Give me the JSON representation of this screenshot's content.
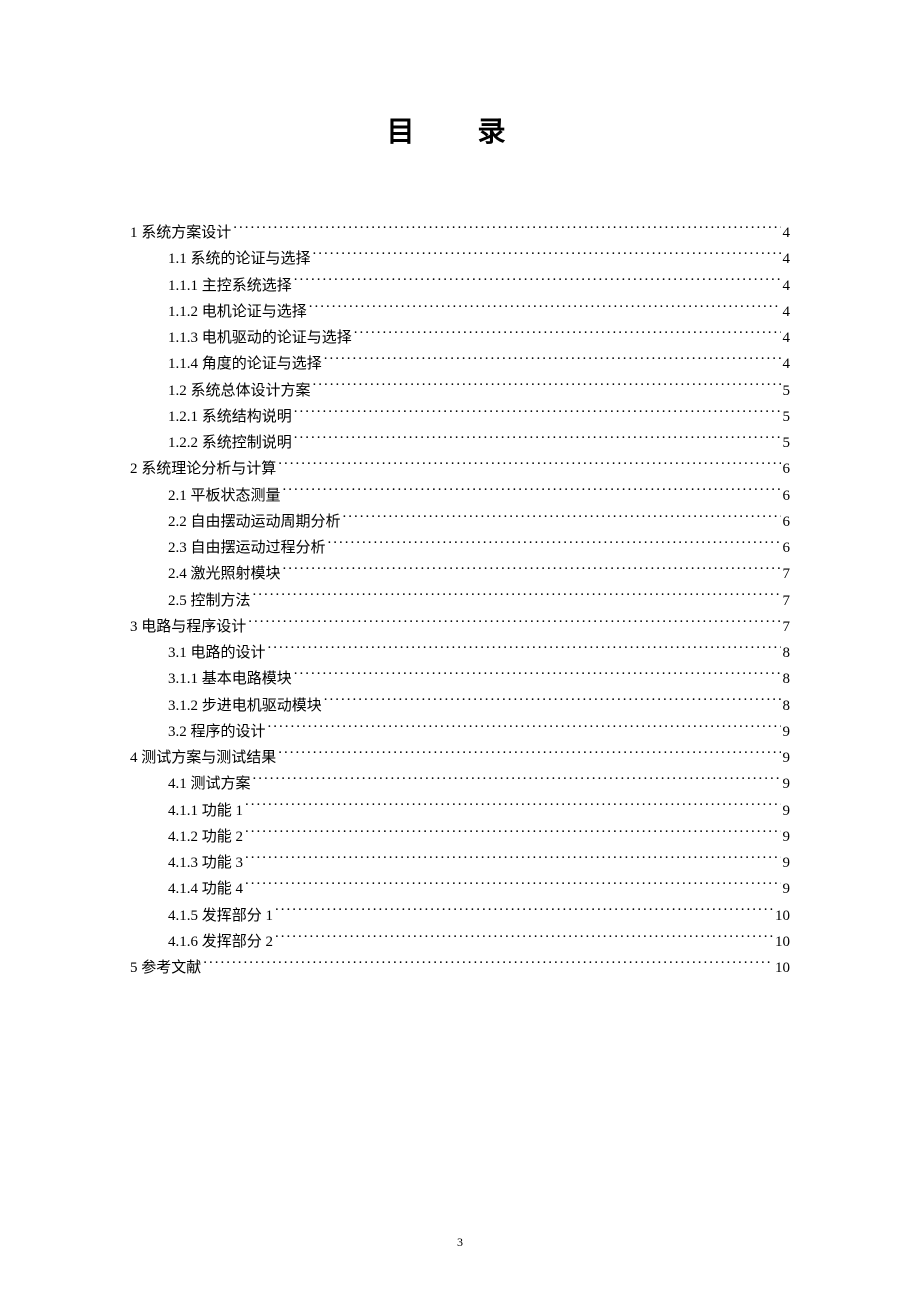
{
  "title": "目 录",
  "footer_page": "3",
  "toc": [
    {
      "level": 0,
      "label": "1 系统方案设计",
      "page": "4"
    },
    {
      "level": 1,
      "label": "1.1  系统的论证与选择",
      "page": "4"
    },
    {
      "level": 1,
      "label": "1.1.1 主控系统选择",
      "page": "4"
    },
    {
      "level": 1,
      "label": "1.1.2  电机论证与选择",
      "page": "4"
    },
    {
      "level": 1,
      "label": "1.1.3  电机驱动的论证与选择",
      "page": "4"
    },
    {
      "level": 1,
      "label": "1.1.4  角度的论证与选择",
      "page": "4"
    },
    {
      "level": 1,
      "label": "1.2  系统总体设计方案",
      "page": "5"
    },
    {
      "level": 1,
      "label": "1.2.1 系统结构说明",
      "page": "5"
    },
    {
      "level": 1,
      "label": "1.2.2  系统控制说明",
      "page": "5"
    },
    {
      "level": 0,
      "label": "2 系统理论分析与计算",
      "page": "6"
    },
    {
      "level": 1,
      "label": "2.1    平板状态测量",
      "page": "6"
    },
    {
      "level": 1,
      "label": "2.2 自由摆动运动周期分析",
      "page": "6"
    },
    {
      "level": 1,
      "label": "2.3 自由摆运动过程分析",
      "page": "6"
    },
    {
      "level": 1,
      "label": "2.4 激光照射模块",
      "page": "7"
    },
    {
      "level": 1,
      "label": "2.5 控制方法",
      "page": "7"
    },
    {
      "level": 0,
      "label": "3 电路与程序设计",
      "page": "7"
    },
    {
      "level": 1,
      "label": "3.1 电路的设计",
      "page": "8"
    },
    {
      "level": 1,
      "label": "3.1.1 基本电路模块",
      "page": "8"
    },
    {
      "level": 1,
      "label": "3.1.2  步进电机驱动模块",
      "page": "8"
    },
    {
      "level": 1,
      "label": "3.2 程序的设计",
      "page": "9"
    },
    {
      "level": 0,
      "label": "4 测试方案与测试结果",
      "page": "9"
    },
    {
      "level": 1,
      "label": "4.1 测试方案",
      "page": "9"
    },
    {
      "level": 1,
      "label": "4.1.1  功能 1",
      "page": "9"
    },
    {
      "level": 1,
      "label": "4.1.2  功能 2",
      "page": "9"
    },
    {
      "level": 1,
      "label": "4.1.3 功能 3",
      "page": "9"
    },
    {
      "level": 1,
      "label": "4.1.4 功能 4",
      "page": "9"
    },
    {
      "level": 1,
      "label": "4.1.5 发挥部分 1",
      "page": "10"
    },
    {
      "level": 1,
      "label": "4.1.6 发挥部分 2",
      "page": "10"
    },
    {
      "level": 0,
      "label": "5 参考文献",
      "page": "10"
    }
  ]
}
